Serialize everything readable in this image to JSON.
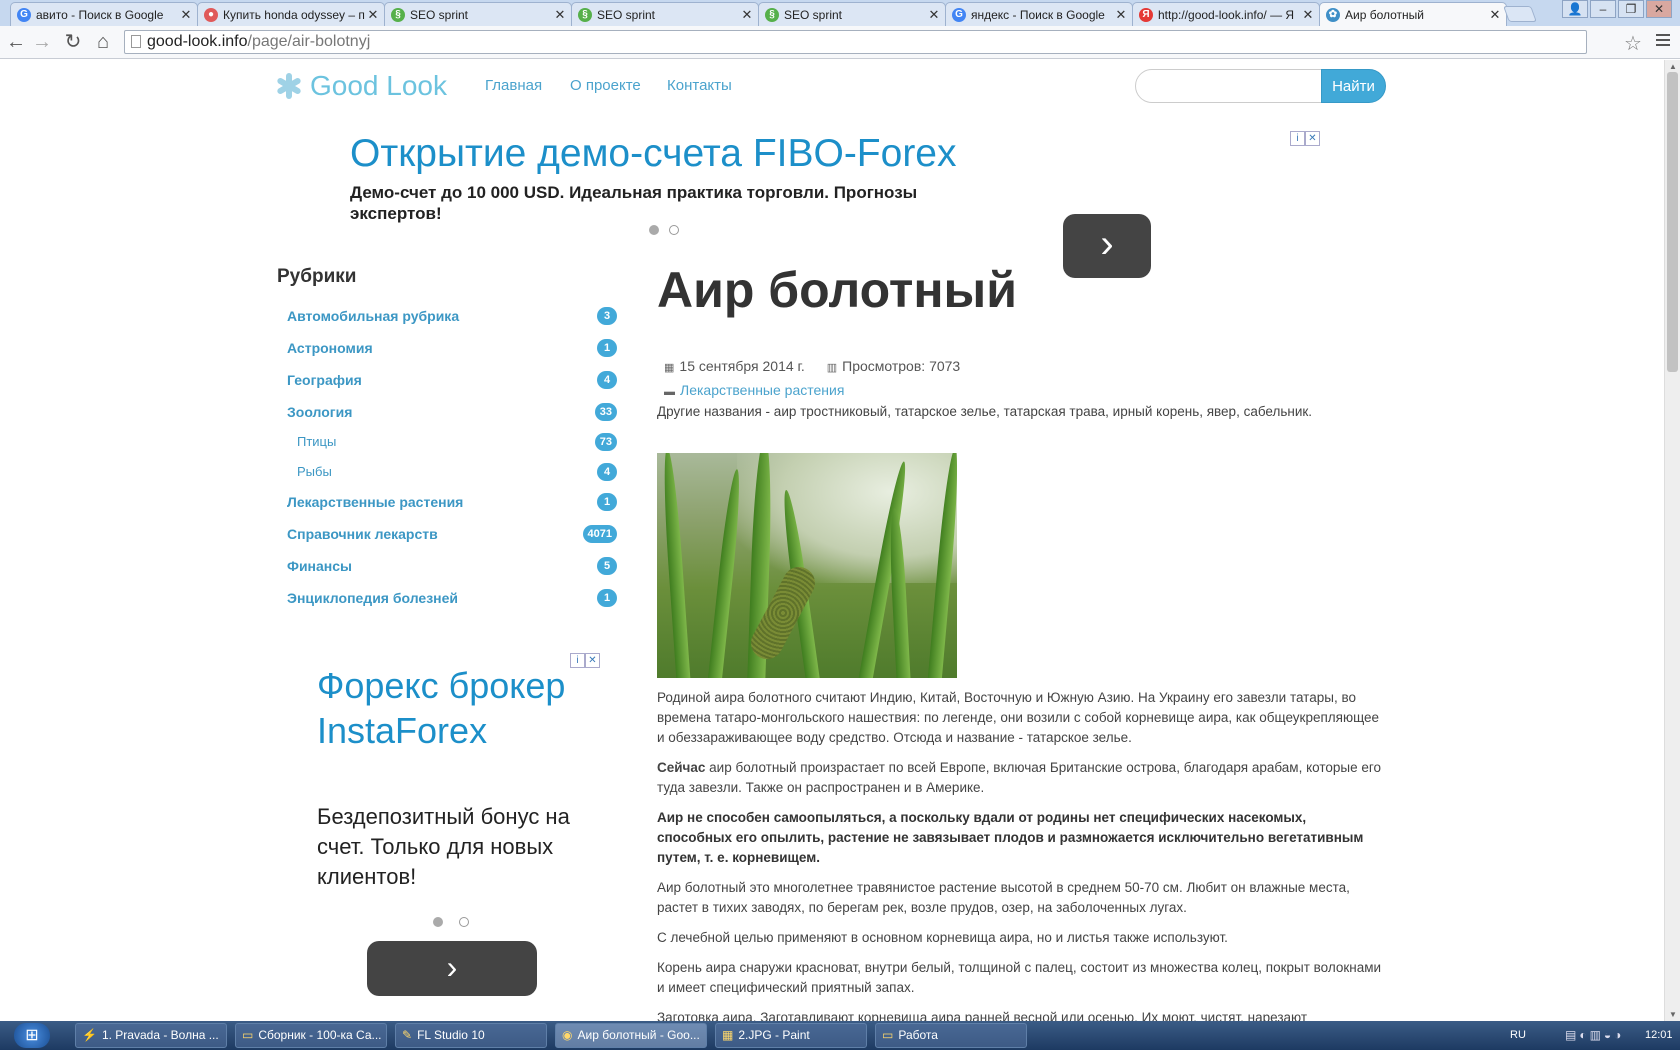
{
  "browser": {
    "tabs": [
      {
        "title": "авито - Поиск в Google",
        "icon": "google-icon",
        "color": "#4285f4",
        "glyph": "G"
      },
      {
        "title": "Купить honda odyssey – п",
        "icon": "avito-icon",
        "color": "#e05a5a",
        "glyph": "●"
      },
      {
        "title": "SEO sprint",
        "icon": "seosprint-icon",
        "color": "#56b04a",
        "glyph": "§"
      },
      {
        "title": "SEO sprint",
        "icon": "seosprint-icon",
        "color": "#56b04a",
        "glyph": "§"
      },
      {
        "title": "SEO sprint",
        "icon": "seosprint-icon",
        "color": "#56b04a",
        "glyph": "§"
      },
      {
        "title": "яндекс - Поиск в Google",
        "icon": "google-icon",
        "color": "#4285f4",
        "glyph": "G"
      },
      {
        "title": "http://good-look.info/ — Я",
        "icon": "yandex-icon",
        "color": "#e53935",
        "glyph": "Я"
      },
      {
        "title": "Аир болотный",
        "icon": "goodlook-icon",
        "color": "#3f8fc7",
        "glyph": "✿"
      }
    ],
    "url_host": "good-look.info",
    "url_path": "/page/air-bolotnyj"
  },
  "site": {
    "logo_text": "Good Look",
    "nav": [
      "Главная",
      "О проекте",
      "Контакты"
    ],
    "search_button": "Найти",
    "search_placeholder": ""
  },
  "top_ad": {
    "title": "Открытие демо-счета FIBO-Forex",
    "text": "Демо-счет до 10 000 USD. Идеальная практика торговли. Прогнозы экспертов!",
    "button_glyph": "›"
  },
  "sidebar": {
    "title": "Рубрики",
    "categories": [
      {
        "label": "Автомобильная рубрика",
        "count": "3",
        "sub": false
      },
      {
        "label": "Астрономия",
        "count": "1",
        "sub": false
      },
      {
        "label": "География",
        "count": "4",
        "sub": false
      },
      {
        "label": "Зоология",
        "count": "33",
        "sub": false
      },
      {
        "label": "Птицы",
        "count": "73",
        "sub": true
      },
      {
        "label": "Рыбы",
        "count": "4",
        "sub": true
      },
      {
        "label": "Лекарственные растения",
        "count": "1",
        "sub": false
      },
      {
        "label": "Справочник лекарств",
        "count": "4071",
        "sub": false
      },
      {
        "label": "Финансы",
        "count": "5",
        "sub": false
      },
      {
        "label": "Энциклопедия болезней",
        "count": "1",
        "sub": false
      }
    ],
    "ad": {
      "title": "Форекс брокер InstaForex",
      "text": "Бездепозитный бонус на счет. Только для новых клиентов!",
      "button_glyph": "›"
    }
  },
  "article": {
    "title": "Аир болотный",
    "date": "15 сентября 2014 г.",
    "views": "Просмотров: 7073",
    "category": "Лекарственные растения",
    "intro": "Другие названия - аир тростниковый, татарское зелье, татарская трава, ирный корень, явер, сабельник.",
    "p1": "Родиной аира болотного считают Индию, Китай, Восточную и Южную Азию. На Украину его завезли татары, во времена татаро-монгольского нашествия: по легенде, они возили с собой корневище аира, как общеукрепляющее и обеззараживающее воду средство. Отсюда и название - татарское зелье.",
    "p2_bold": "Сейчас",
    "p2": " аир болотный произрастает по всей Европе, включая Британские острова, благодаря арабам, которые его туда завезли. Также он распространен и в Америке.",
    "p3": "Аир не способен самоопыляться, а поскольку вдали от родины нет специфических насекомых, способных его опылить, растение не завязывает плодов и размножается исключительно вегетативным путем, т. е. корневищем.",
    "p4": "Аир болотный это многолетнее травянистое растение высотой в среднем 50-70 см. Любит он влажные места, растет в тихих заводях, по берегам рек, возле прудов, озер, на заболоченных лугах.",
    "p5": "С лечебной целью применяют в основном корневища аира, но и листья также используют.",
    "p6": "Корень аира снаружи красноват, внутри белый, толщиной с палец, состоит из множества колец, покрыт волокнами и имеет специфический приятный запах.",
    "p7": "Заготовка аира. Заготавливают корневища аира ранней весной или осенью. Их моют, чистят, нарезают"
  },
  "taskbar": {
    "items": [
      {
        "label": "1. Pravada  - Волна ...",
        "icon": "winamp-icon",
        "glyph": "⚡"
      },
      {
        "label": "Сборник - 100-ка Са...",
        "icon": "folder-icon",
        "glyph": "▭"
      },
      {
        "label": "FL Studio 10",
        "icon": "flstudio-icon",
        "glyph": "✎"
      },
      {
        "label": "Аир болотный - Goo...",
        "icon": "chrome-icon",
        "glyph": "◉"
      },
      {
        "label": "2.JPG - Paint",
        "icon": "paint-icon",
        "glyph": "▦"
      },
      {
        "label": "Работа",
        "icon": "folder-icon",
        "glyph": "▭"
      }
    ],
    "lang": "RU",
    "time": "12:01"
  }
}
